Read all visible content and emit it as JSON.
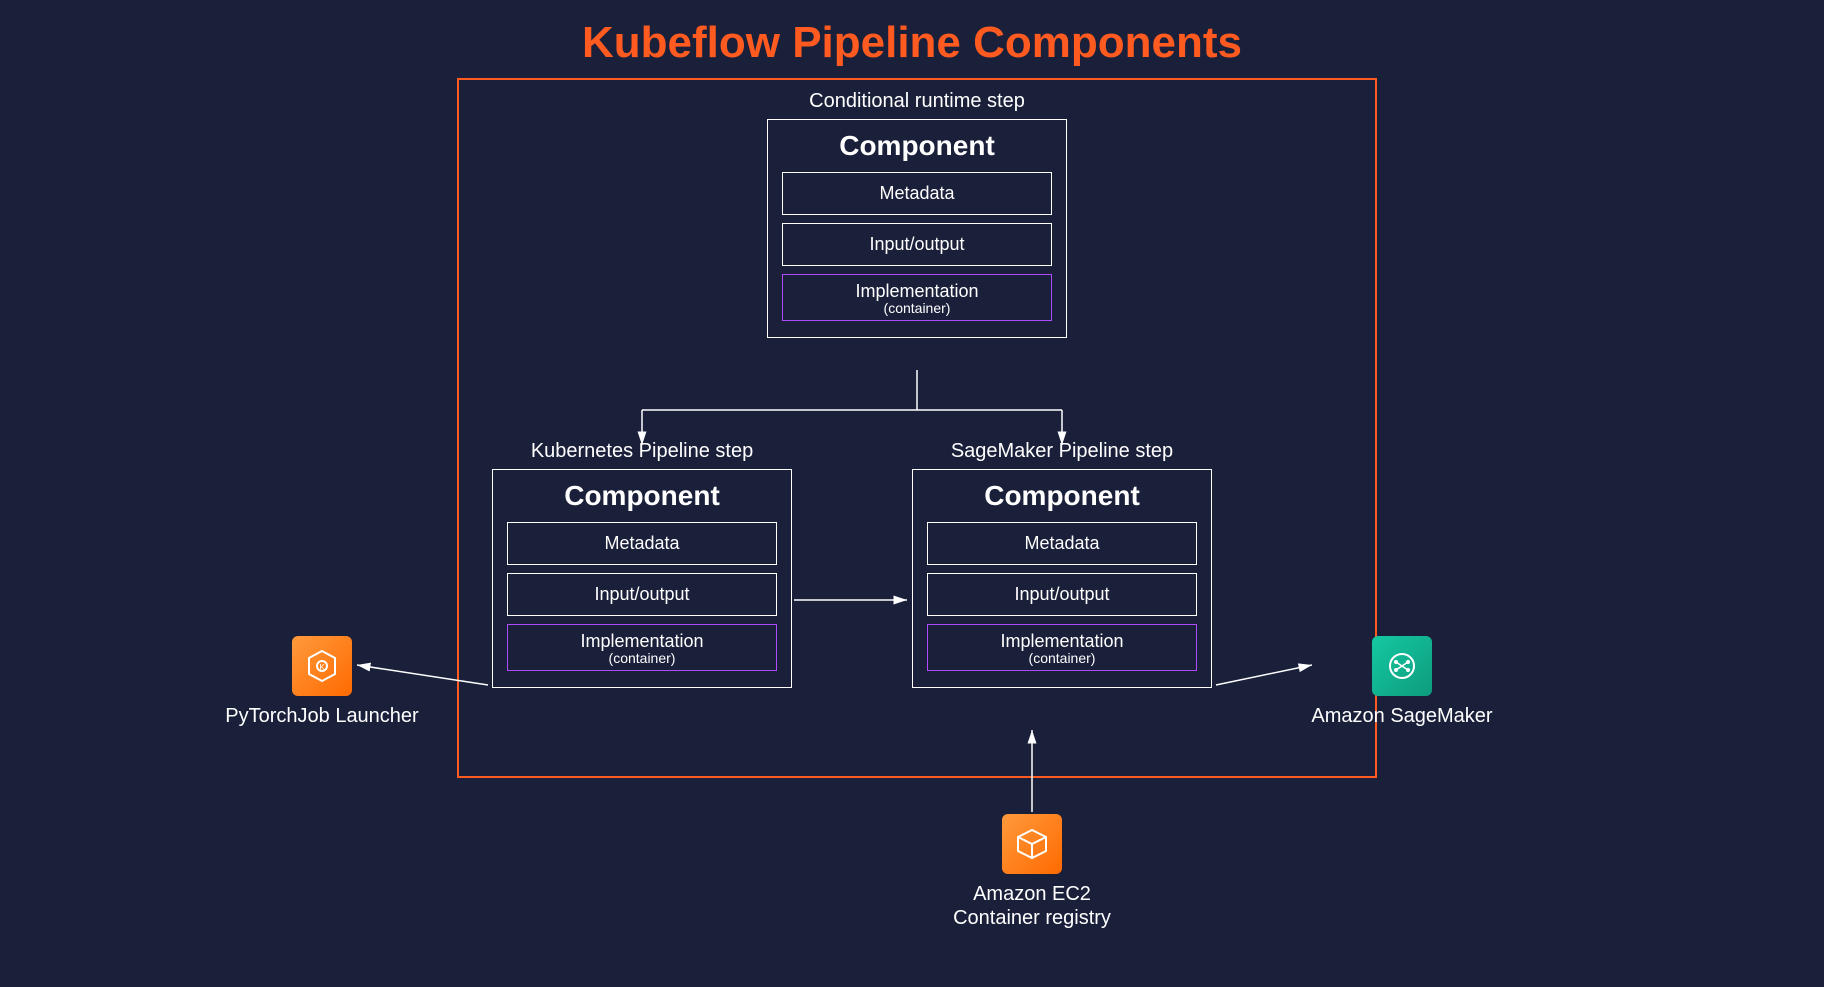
{
  "title": "Kubeflow Pipeline Components",
  "steps": {
    "top": {
      "label": "Conditional runtime step",
      "heading": "Component",
      "box1": "Metadata",
      "box2": "Input/output",
      "impl": "Implementation",
      "impl_sub": "(container)"
    },
    "left": {
      "label": "Kubernetes Pipeline step",
      "heading": "Component",
      "box1": "Metadata",
      "box2": "Input/output",
      "impl": "Implementation",
      "impl_sub": "(container)"
    },
    "right": {
      "label": "SageMaker Pipeline step",
      "heading": "Component",
      "box1": "Metadata",
      "box2": "Input/output",
      "impl": "Implementation",
      "impl_sub": "(container)"
    }
  },
  "external": {
    "left": {
      "label": "PyTorchJob Launcher",
      "icon": "kubernetes-hex-icon"
    },
    "right": {
      "label": "Amazon SageMaker",
      "icon": "sagemaker-icon"
    },
    "bottom": {
      "label_line1": "Amazon EC2",
      "label_line2": "Container registry",
      "icon": "ecr-cube-icon"
    }
  },
  "colors": {
    "bg": "#1a1f3a",
    "accent": "#ff5a1f",
    "purple": "#b04aff",
    "green": "#14c9a2"
  }
}
